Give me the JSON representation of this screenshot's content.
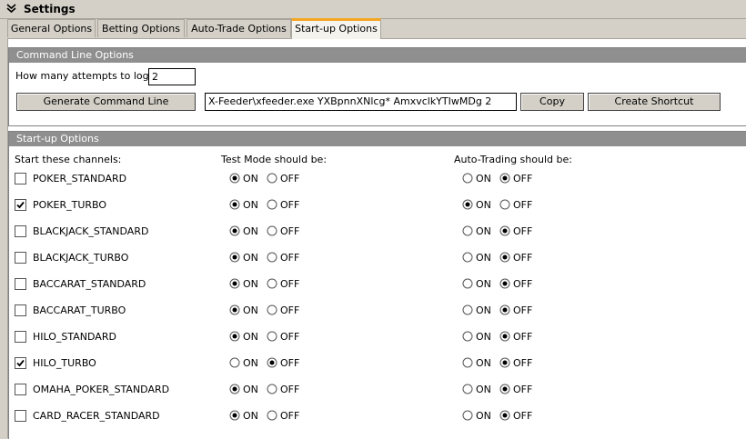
{
  "window": {
    "title": "Settings"
  },
  "tabs": [
    {
      "label": "General Options",
      "active": false
    },
    {
      "label": "Betting Options",
      "active": false
    },
    {
      "label": "Auto-Trade Options",
      "active": false
    },
    {
      "label": "Start-up Options",
      "active": true
    }
  ],
  "command_line": {
    "header": "Command Line Options",
    "attempts_label": "How many attempts to log in:",
    "attempts_value": "2",
    "generate_button": "Generate Command Line",
    "command_value": "X-Feeder\\xfeeder.exe YXBpnnXNlcg* AmxvclkYTIwMDg 2",
    "copy_button": "Copy",
    "shortcut_button": "Create Shortcut"
  },
  "startup": {
    "header": "Start-up Options",
    "col_channels": "Start these channels:",
    "col_test": "Test Mode should be:",
    "col_auto": "Auto-Trading should be:",
    "on_label": "ON",
    "off_label": "OFF",
    "channels": [
      {
        "name": "POKER_STANDARD",
        "checked": false,
        "test_on": true,
        "auto_on": false
      },
      {
        "name": "POKER_TURBO",
        "checked": true,
        "test_on": true,
        "auto_on": true
      },
      {
        "name": "BLACKJACK_STANDARD",
        "checked": false,
        "test_on": true,
        "auto_on": false
      },
      {
        "name": "BLACKJACK_TURBO",
        "checked": false,
        "test_on": true,
        "auto_on": false
      },
      {
        "name": "BACCARAT_STANDARD",
        "checked": false,
        "test_on": true,
        "auto_on": false
      },
      {
        "name": "BACCARAT_TURBO",
        "checked": false,
        "test_on": true,
        "auto_on": false
      },
      {
        "name": "HILO_STANDARD",
        "checked": false,
        "test_on": true,
        "auto_on": false
      },
      {
        "name": "HILO_TURBO",
        "checked": true,
        "test_on": false,
        "auto_on": false
      },
      {
        "name": "OMAHA_POKER_STANDARD",
        "checked": false,
        "test_on": true,
        "auto_on": false
      },
      {
        "name": "CARD_RACER_STANDARD",
        "checked": false,
        "test_on": true,
        "auto_on": false
      }
    ]
  }
}
